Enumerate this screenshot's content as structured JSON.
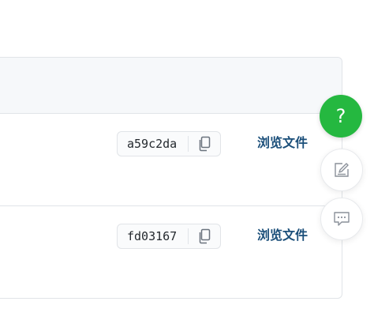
{
  "commits": [
    {
      "sha": "a59c2da",
      "browse_label": "浏览文件"
    },
    {
      "sha": "fd03167",
      "browse_label": "浏览文件"
    }
  ],
  "floating": {
    "help_glyph": "?"
  },
  "colors": {
    "help_button": "#25b840",
    "link": "#1b4f7a",
    "border": "#e1e4e8"
  },
  "icons": {
    "copy": "copy-icon",
    "edit": "edit-icon",
    "chat": "chat-icon"
  }
}
